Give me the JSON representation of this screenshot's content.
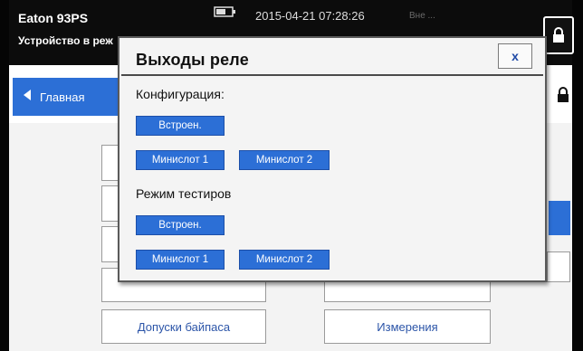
{
  "header": {
    "model": "Eaton 93PS",
    "device_mode": "Устройство в реж",
    "datetime": "2015-04-21 07:28:26",
    "status_text": "Вне ..."
  },
  "nav": {
    "back_label": "Главная"
  },
  "background_menu": {
    "bypass_limits": "Допуски байпаса",
    "measurements": "Измерения",
    "partial_left": "",
    "partial_right": ""
  },
  "dialog": {
    "title": "Выходы реле",
    "close_label": "x",
    "config_label": "Конфигурация:",
    "config_builtin": "Встроен.",
    "config_minislot1": "Минислот 1",
    "config_minislot2": "Минислот 2",
    "test_label": "Режим тестиров",
    "test_builtin": "Встроен.",
    "test_minislot1": "Минислот 1",
    "test_minislot2": "Минислот 2"
  },
  "colors": {
    "accent_blue": "#2c6fd6",
    "topbar": "#0c0c0c"
  }
}
